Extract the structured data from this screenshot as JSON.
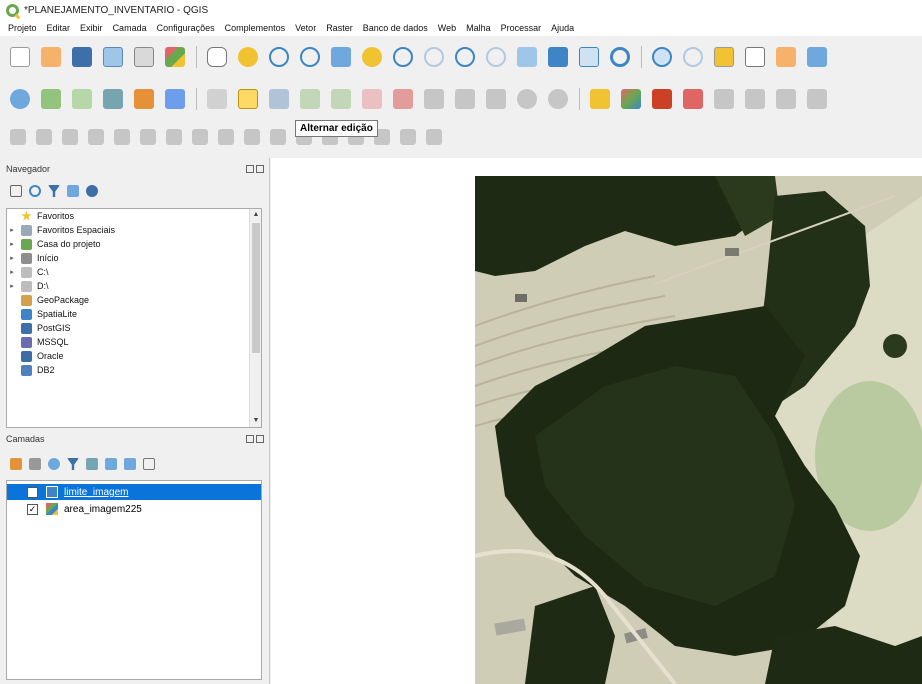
{
  "window": {
    "title": "*PLANEJAMENTO_INVENTARIO - QGIS"
  },
  "menu": [
    "Projeto",
    "Editar",
    "Exibir",
    "Camada",
    "Configurações",
    "Complementos",
    "Vetor",
    "Raster",
    "Banco de dados",
    "Web",
    "Malha",
    "Processar",
    "Ajuda"
  ],
  "tooltip": "Alternar edição",
  "navigator": {
    "title": "Navegador",
    "items": [
      {
        "label": "Favoritos",
        "icon": "star-icon",
        "color": "#f1c232",
        "expandable": false
      },
      {
        "label": "Favoritos Espaciais",
        "icon": "spatial-bookmarks-icon",
        "color": "#9aa9b8",
        "expandable": true
      },
      {
        "label": "Casa do projeto",
        "icon": "project-home-icon",
        "color": "#6aa84f",
        "expandable": true
      },
      {
        "label": "Início",
        "icon": "home-folder-icon",
        "color": "#8e8e8e",
        "expandable": true
      },
      {
        "label": "C:\\",
        "icon": "drive-c-icon",
        "color": "#bdbdbd",
        "expandable": true
      },
      {
        "label": "D:\\",
        "icon": "drive-d-icon",
        "color": "#bdbdbd",
        "expandable": true
      },
      {
        "label": "GeoPackage",
        "icon": "geopackage-icon",
        "color": "#d4a04c",
        "expandable": false
      },
      {
        "label": "SpatiaLite",
        "icon": "spatialite-icon",
        "color": "#3d85c6",
        "expandable": false
      },
      {
        "label": "PostGIS",
        "icon": "postgis-icon",
        "color": "#3d6fa8",
        "expandable": false
      },
      {
        "label": "MSSQL",
        "icon": "mssql-icon",
        "color": "#6b6bb0",
        "expandable": false
      },
      {
        "label": "Oracle",
        "icon": "oracle-icon",
        "color": "#3a6ea5",
        "expandable": false
      },
      {
        "label": "DB2",
        "icon": "db2-icon",
        "color": "#4f81bd",
        "expandable": false
      }
    ]
  },
  "layers": {
    "title": "Camadas",
    "items": [
      {
        "label": "limite_imagem",
        "checked": false,
        "selected": true,
        "icon": "polygon-layer-icon"
      },
      {
        "label": "area_imagem225",
        "checked": true,
        "selected": false,
        "icon": "raster-layer-icon"
      }
    ]
  },
  "colors": {
    "selection": "#0a74da",
    "accent": "#6aa84f"
  }
}
